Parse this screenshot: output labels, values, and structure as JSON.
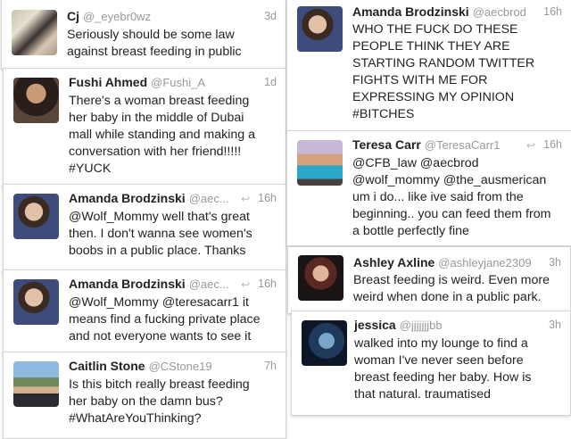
{
  "tweets": [
    {
      "name": "Cj",
      "handle": "@_eyebr0wz",
      "time": "3d",
      "lines": [
        "Seriously should be some law",
        "against breast feeding in public"
      ]
    },
    {
      "name": "Fushi Ahmed",
      "handle": "@Fushi_A",
      "time": "1d",
      "lines": [
        "There's a woman breast feeding",
        "her baby in the middle of Dubai",
        "mall while standing and making a",
        "conversation with her friend!!!!!",
        "#YUCK"
      ]
    },
    {
      "name": "Amanda Brodzinski",
      "handle": "@aec...",
      "time": "16h",
      "lines": [
        "@Wolf_Mommy well that's great",
        "then. I don't wanna see women's",
        "boobs in a public place. Thanks"
      ]
    },
    {
      "name": "Amanda Brodzinski",
      "handle": "@aec...",
      "time": "16h",
      "lines": [
        "@Wolf_Mommy @teresacarr1 it",
        "means find a fucking private place",
        "and not everyone wants to see it"
      ]
    },
    {
      "name": "Caitlin Stone",
      "handle": "@CStone19",
      "time": "7h",
      "lines": [
        "Is this bitch really breast feeding",
        "her baby on the damn bus?",
        "#WhatAreYouThinking?"
      ]
    },
    {
      "name": "Amanda Brodzinski",
      "handle": "@aecbrod",
      "time": "16h",
      "lines": [
        "WHO THE FUCK DO THESE",
        "PEOPLE THINK THEY ARE",
        "STARTING RANDOM TWITTER",
        "FIGHTS WITH ME FOR",
        "EXPRESSING MY OPINION",
        "#BITCHES"
      ]
    },
    {
      "name": "Teresa Carr",
      "handle": "@TeresaCarr1",
      "time": "16h",
      "lines": [
        "@CFB_law @aecbrod",
        "@wolf_mommy @the_ausmerican",
        "um i do... like ive said from the",
        "beginning.. you can feed them from",
        "a bottle perfectly fine"
      ]
    },
    {
      "name": "Ashley Axline",
      "handle": "@ashleyjane2309",
      "time": "3h",
      "lines": [
        "Breast feeding is weird. Even more",
        "weird when done in a public park."
      ]
    },
    {
      "name": "jessica",
      "handle": "@jjjjjjjbb",
      "time": "3h",
      "lines": [
        "walked into my lounge to find a",
        "woman I've never seen before",
        "breast feeding her baby. How is",
        "that natural. traumatised"
      ]
    }
  ]
}
